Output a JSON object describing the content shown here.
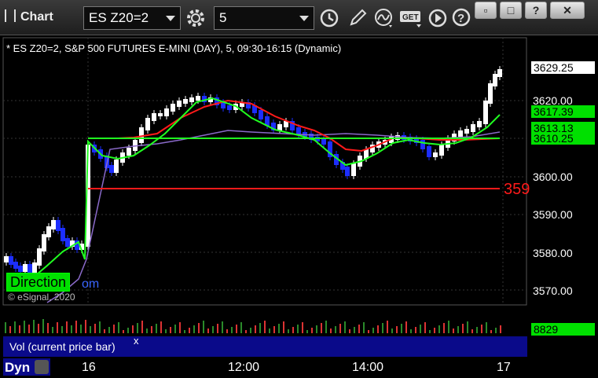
{
  "app": {
    "title": "Chart"
  },
  "toolbar": {
    "symbol": "ES Z20=2",
    "interval": "5"
  },
  "window_buttons": {
    "help": "?",
    "restore": "▫",
    "maximize": "□",
    "close": "✕"
  },
  "chart": {
    "info_line": "* ES Z20=2, S&P 500 FUTURES E-MINI (DAY), 5, 09:30-16:15 (Dynamic)",
    "price_ticks": [
      "3600.00",
      "3610.00",
      "3620.00",
      "3590.00",
      "3580.00",
      "3570.00"
    ],
    "price_tags": [
      {
        "value": "3629.25",
        "bg": "#ffffff",
        "fg": "#000000"
      },
      {
        "value": "3617.39",
        "bg": "#00e000",
        "fg": "#000000"
      },
      {
        "value": "3613.13",
        "bg": "#00e000",
        "fg": "#000000"
      },
      {
        "value": "3610.25",
        "bg": "#00e000",
        "fg": "#000000"
      }
    ],
    "red_level_label": "359",
    "time_ticks": [
      "16",
      "12:00",
      "14:00",
      "17"
    ],
    "direction_label": "Direction",
    "watermark": "© eSignal, 2020",
    "watermark_partial": "om"
  },
  "volume": {
    "panel_label": "Vol (current price bar)",
    "close": "x",
    "value": "8829"
  },
  "bottom": {
    "dyn": "Dyn"
  },
  "colors": {
    "up": "#ffffff",
    "down": "#1c2eff",
    "ma_red": "#ff1a1a",
    "ma_green": "#20ff20",
    "ma_purple": "#8a6ac9"
  }
}
